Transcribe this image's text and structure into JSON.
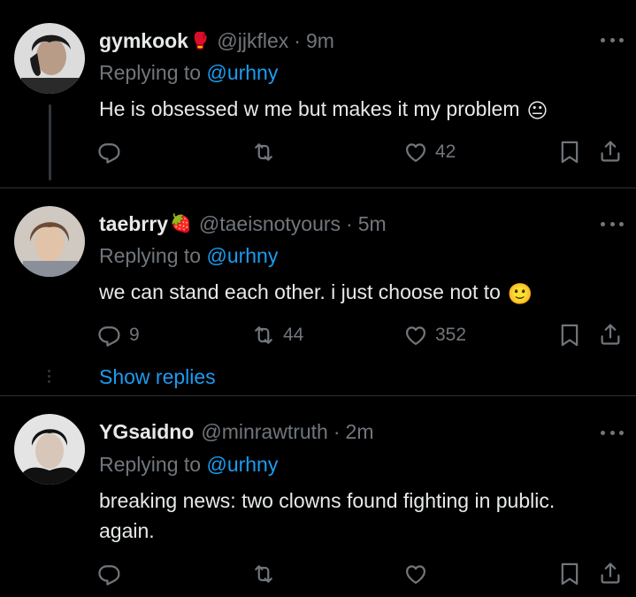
{
  "tweets": [
    {
      "name": "gymkook",
      "name_emoji": "🥊",
      "handle": "@jjkflex",
      "time": "9m",
      "replying_prefix": "Replying to ",
      "replying_handle": "@urhny",
      "text": "He is obsessed w me but makes it my problem",
      "text_emoji": "😐",
      "replies": "",
      "retweets": "",
      "likes": "42"
    },
    {
      "name": "taebrry",
      "name_emoji": "🍓",
      "handle": "@taeisnotyours",
      "time": "5m",
      "replying_prefix": "Replying to ",
      "replying_handle": "@urhny",
      "text": "we can stand each other. i just choose not to",
      "text_emoji": "🙂",
      "replies": "9",
      "retweets": "44",
      "likes": "352",
      "show_replies": "Show replies"
    },
    {
      "name": "YGsaidno",
      "handle": "@minrawtruth",
      "time": "2m",
      "replying_prefix": "Replying to ",
      "replying_handle": "@urhny",
      "text_line1": "breaking news: two clowns found fighting in public.",
      "text_line2": "again.",
      "replies": "",
      "retweets": "",
      "likes": ""
    }
  ],
  "separator": "·",
  "colors": {
    "background": "#000000",
    "text": "#e7e9ea",
    "secondary": "#71767b",
    "accent": "#1d9bf0",
    "divider": "#2f3336"
  },
  "icons": [
    "reply-icon",
    "retweet-icon",
    "like-icon",
    "bookmark-icon",
    "share-icon",
    "more-icon"
  ]
}
